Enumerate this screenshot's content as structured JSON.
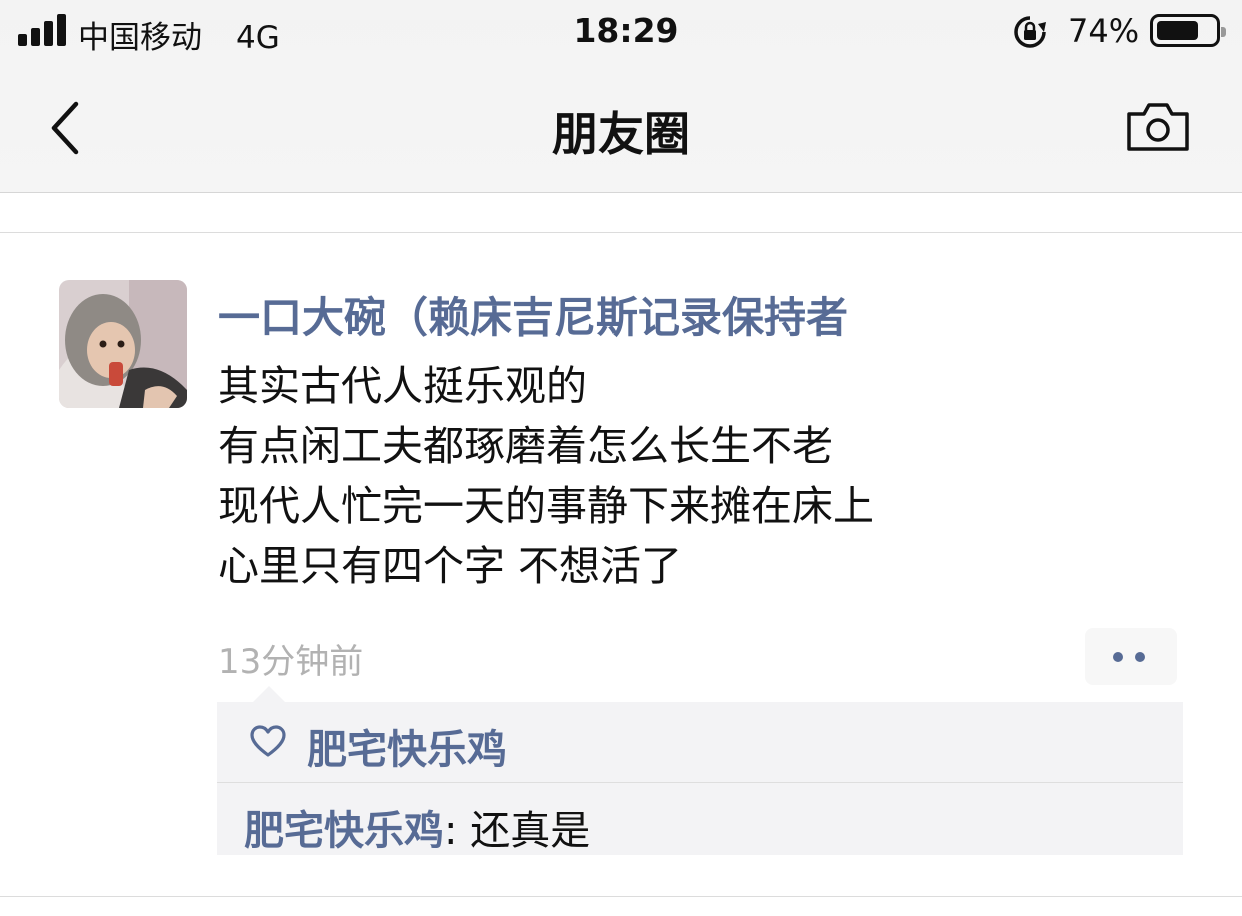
{
  "status_bar": {
    "carrier": "中国移动",
    "network": "4G",
    "time": "18:29",
    "battery_percent": "74%",
    "battery_level": 0.74
  },
  "nav": {
    "title": "朋友圈",
    "back_icon": "chevron-left-icon",
    "camera_icon": "camera-icon"
  },
  "post": {
    "nickname": "一口大碗（赖床吉尼斯记录保持者",
    "lines": [
      "其实古代人挺乐观的",
      "有点闲工夫都琢磨着怎么长生不老",
      "现代人忙完一天的事静下来摊在床上",
      "心里只有四个字 不想活了"
    ],
    "time_ago": "13分钟前",
    "likes": [
      "肥宅快乐鸡"
    ],
    "comments": [
      {
        "author": "肥宅快乐鸡",
        "separator": ": ",
        "text": "还真是"
      }
    ]
  },
  "colors": {
    "link": "#576b95",
    "timestamp": "#b2b2b2",
    "interact_bg": "#f3f3f5",
    "nav_bg": "#f4f4f4"
  }
}
